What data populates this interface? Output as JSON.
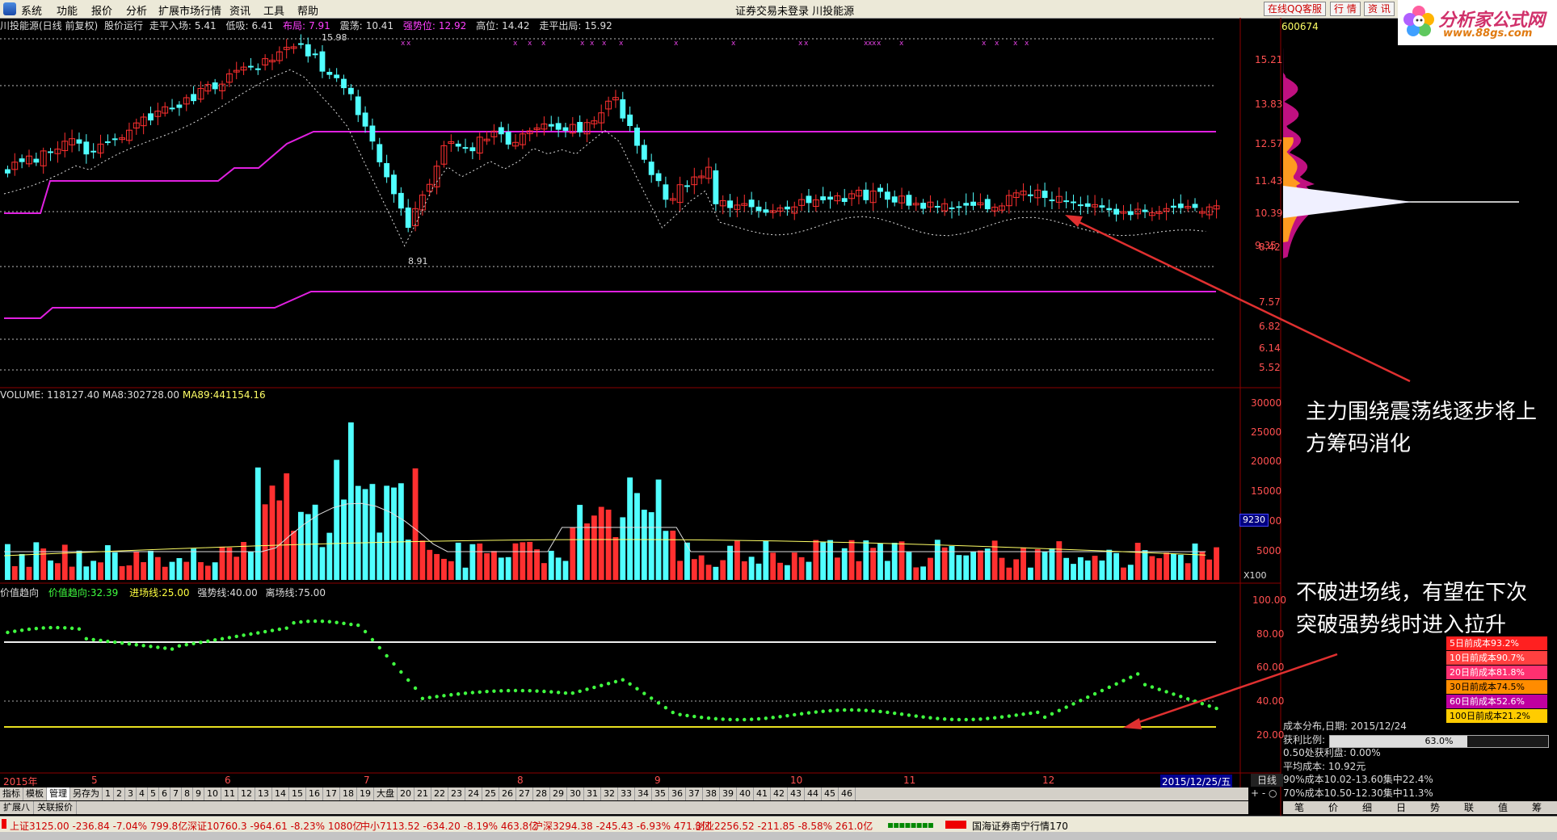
{
  "menubar": {
    "items": [
      "系统",
      "功能",
      "报价",
      "分析",
      "扩展市场行情",
      "资讯",
      "工具",
      "帮助"
    ],
    "center_text": "证券交易未登录   川投能源",
    "qq_label": "在线QQ客服",
    "hq_label": "行 情",
    "news_label": "资 讯"
  },
  "logo": {
    "title": "分析家公式网",
    "url": "www.88gs.com"
  },
  "stock_code": "600674",
  "infobar": {
    "name": "川投能源(日线 前复权)",
    "mode": "股价运行",
    "entry_label": "走平入场:",
    "entry_val": "5.41",
    "low_label": "低吸:",
    "low_val": "6.41",
    "layout_label": "布局:",
    "layout_val": "7.91",
    "shock_label": "震荡:",
    "shock_val": "10.41",
    "strong_label": "强势位:",
    "strong_val": "12.92",
    "high_label": "高位:",
    "high_val": "14.42",
    "exit_label": "走平出局:",
    "exit_val": "15.92"
  },
  "price_axis": [
    "15.21",
    "13.83",
    "12.57",
    "11.43",
    "10.39",
    "9.35",
    "8.42",
    "7.57",
    "6.82",
    "6.14",
    "5.52"
  ],
  "price_marks": {
    "high": "15.98",
    "low": "8.91"
  },
  "volume": {
    "label": "VOLUME:",
    "vol": "118127.40",
    "ma8_label": "MA8:",
    "ma8": "302728.00",
    "ma89_label": "MA89:",
    "ma89": "441154.16",
    "axis": [
      "30000",
      "25000",
      "20000",
      "15000",
      "10000",
      "5000"
    ],
    "badge": "9230",
    "unit": "X100"
  },
  "indicator": {
    "name": "价值趋向",
    "trend_label": "价值趋向:",
    "trend_val": "32.39",
    "entry_label": "进场线:",
    "entry_val": "25.00",
    "strong_label": "强势线:",
    "strong_val": "40.00",
    "exit_label": "离场线:",
    "exit_val": "75.00",
    "axis": [
      "100.00",
      "80.00",
      "60.00",
      "40.00",
      "20.00"
    ]
  },
  "annotations": {
    "a1": "主力围绕震荡线逐步将上方筹码消化",
    "a2": "不破进场线，有望在下次突破强势线时进入拉升"
  },
  "cost_table": [
    {
      "label": "5日前成本93.2%",
      "color": "#ff2020"
    },
    {
      "label": "10日前成本90.7%",
      "color": "#ff4040"
    },
    {
      "label": "20日前成本81.8%",
      "color": "#ff3070"
    },
    {
      "label": "30日前成本74.5%",
      "color": "#ff8c00"
    },
    {
      "label": "60日前成本52.6%",
      "color": "#c000a0"
    },
    {
      "label": "100日前成本21.2%",
      "color": "#ffcc00"
    }
  ],
  "cost_info": {
    "date_label": "成本分布,日期:",
    "date": "2015/12/24",
    "profit_label": "获利比例:",
    "profit_pct": "63.0%",
    "profit_value": 0.63,
    "line1": "0.50处获利盘: 0.00%",
    "line2": "平均成本: 10.92元",
    "line3": "90%成本10.02-13.60集中22.4%",
    "line4": "70%成本10.50-12.30集中11.3%"
  },
  "dates": {
    "items": [
      "2015年",
      "5",
      "6",
      "7",
      "8",
      "9",
      "10",
      "11",
      "12"
    ],
    "current": "2015/12/25/五"
  },
  "daily_label": "日线",
  "zoom_label": "+  -  ○",
  "tabs": [
    "指标",
    "模板",
    "管理",
    "另存为",
    "1",
    "2",
    "3",
    "4",
    "5",
    "6",
    "7",
    "8",
    "9",
    "10",
    "11",
    "12",
    "13",
    "14",
    "15",
    "16",
    "17",
    "18",
    "19",
    "大盘",
    "20",
    "21",
    "22",
    "23",
    "24",
    "25",
    "26",
    "27",
    "28",
    "29",
    "30",
    "31",
    "32",
    "33",
    "34",
    "35",
    "36",
    "37",
    "38",
    "39",
    "40",
    "41",
    "42",
    "43",
    "44",
    "45",
    "46"
  ],
  "tabs2": [
    "扩展八",
    "关联报价"
  ],
  "right_btns": [
    "笔",
    "价",
    "细",
    "日",
    "势",
    "联",
    "值",
    "筹"
  ],
  "status": {
    "sh": "上证3125.00 -236.84 -7.04% 799.8亿",
    "sz": "深证10760.3 -964.61 -8.23% 1080亿",
    "zx": "中小7113.52 -634.20 -8.19% 463.8亿",
    "hs": "沪深3294.38 -245.43 -6.93% 471.3亿",
    "cy": "创业2256.52 -211.85 -8.58% 261.0亿",
    "broker": "国海证券南宁行情170"
  }
}
